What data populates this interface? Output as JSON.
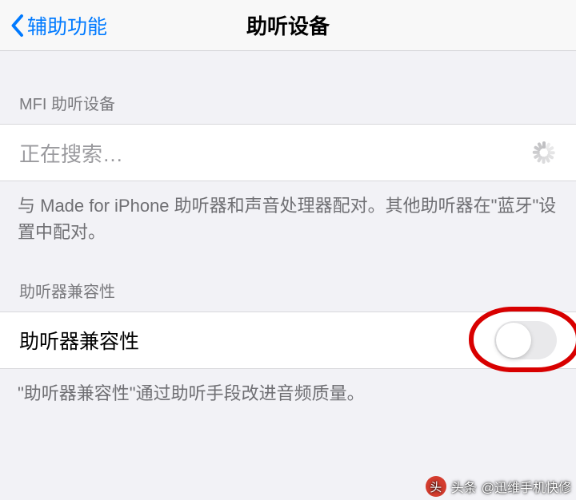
{
  "navbar": {
    "back_label": "辅助功能",
    "title": "助听设备"
  },
  "section1": {
    "header": "MFI 助听设备",
    "searching_text": "正在搜索…",
    "footer": "与 Made for iPhone 助听器和声音处理器配对。其他助听器在\"蓝牙\"设置中配对。"
  },
  "section2": {
    "header": "助听器兼容性",
    "row_label": "助听器兼容性",
    "toggle_on": false,
    "footer": "\"助听器兼容性\"通过助听手段改进音频质量。"
  },
  "watermark": {
    "prefix": "头条",
    "author": "@迅维手机快修"
  }
}
